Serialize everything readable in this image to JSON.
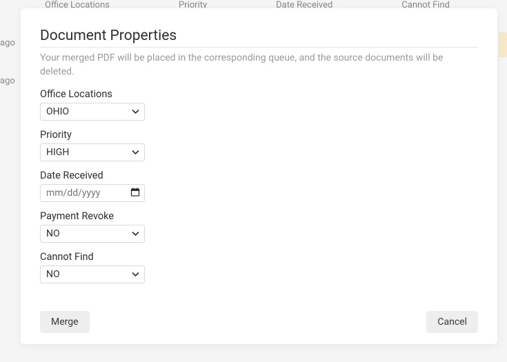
{
  "background": {
    "col1": "Office Locations",
    "col2": "Priority",
    "col3": "Date Received",
    "col4": "Cannot Find",
    "ago1": "ago",
    "ago2": "ago"
  },
  "modal": {
    "title": "Document Properties",
    "subtitle": "Your merged PDF will be placed in the corresponding queue, and the source documents will be deleted."
  },
  "fields": {
    "office": {
      "label": "Office Locations",
      "value": "OHIO"
    },
    "priority": {
      "label": "Priority",
      "value": "HIGH"
    },
    "date": {
      "label": "Date Received",
      "placeholder": "mm/dd/yyyy"
    },
    "revoke": {
      "label": "Payment Revoke",
      "value": "NO"
    },
    "cannot": {
      "label": "Cannot Find",
      "value": "NO"
    }
  },
  "buttons": {
    "merge": "Merge",
    "cancel": "Cancel"
  }
}
